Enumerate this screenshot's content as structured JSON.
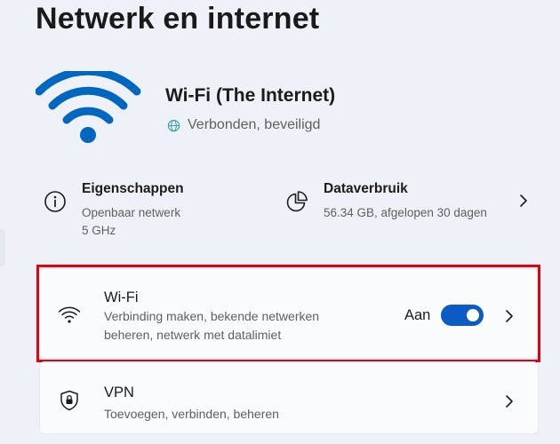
{
  "page": {
    "title": "Netwerk en internet"
  },
  "hero": {
    "icon": "wifi-signal-icon",
    "network_name": "Wi-Fi (The Internet)",
    "status_icon": "globe-icon",
    "status": "Verbonden, beveiligd"
  },
  "tiles": {
    "properties": {
      "icon": "info-icon",
      "title": "Eigenschappen",
      "line1": "Openbaar netwerk",
      "line2": "5 GHz"
    },
    "data_usage": {
      "icon": "pie-chart-icon",
      "title": "Dataverbruik",
      "detail": "56.34 GB, afgelopen 30 dagen"
    }
  },
  "cards": {
    "wifi": {
      "icon": "wifi-icon",
      "title": "Wi-Fi",
      "subtitle": "Verbinding maken, bekende netwerken beheren, netwerk met datalimiet",
      "toggle_label": "Aan",
      "toggle_on": true
    },
    "vpn": {
      "icon": "shield-icon",
      "title": "VPN",
      "subtitle": "Toevoegen, verbinden, beheren"
    }
  },
  "colors": {
    "accent": "#0a5bc4",
    "wifi_blue": "#0067c0",
    "highlight": "#e3000f",
    "background": "#eef2f8"
  }
}
